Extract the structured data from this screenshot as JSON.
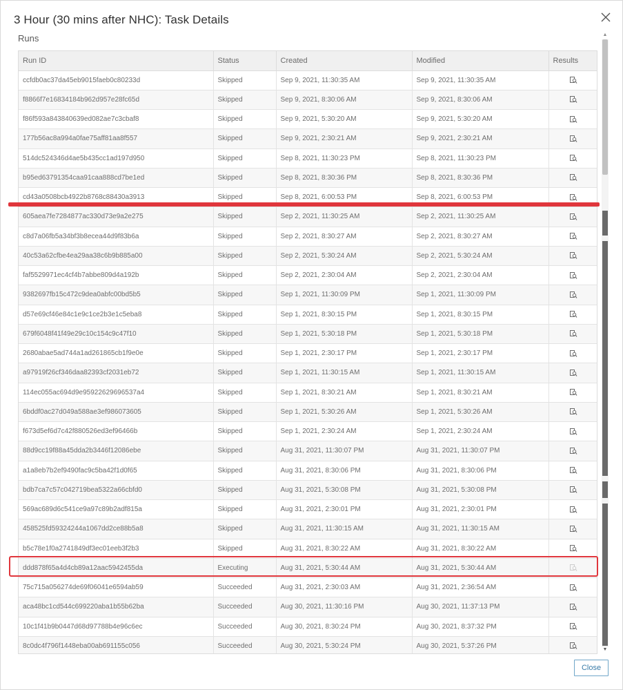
{
  "dialog": {
    "title": "3 Hour (30 mins after NHC): Task Details",
    "section_label": "Runs",
    "close_button_label": "Close"
  },
  "table": {
    "columns": [
      "Run ID",
      "Status",
      "Created",
      "Modified",
      "Results"
    ],
    "rows": [
      {
        "run_id": "ccfdb0ac37da45eb9015faeb0c80233d",
        "status": "Skipped",
        "created": "Sep 9, 2021, 11:30:35 AM",
        "modified": "Sep 9, 2021, 11:30:35 AM",
        "results_icon": "view-results-icon",
        "results_enabled": true
      },
      {
        "run_id": "f8866f7e16834184b962d957e28fc65d",
        "status": "Skipped",
        "created": "Sep 9, 2021, 8:30:06 AM",
        "modified": "Sep 9, 2021, 8:30:06 AM",
        "results_icon": "view-results-icon",
        "results_enabled": true
      },
      {
        "run_id": "f86f593a843840639ed082ae7c3cbaf8",
        "status": "Skipped",
        "created": "Sep 9, 2021, 5:30:20 AM",
        "modified": "Sep 9, 2021, 5:30:20 AM",
        "results_icon": "view-results-icon",
        "results_enabled": true
      },
      {
        "run_id": "177b56ac8a994a0fae75aff81aa8f557",
        "status": "Skipped",
        "created": "Sep 9, 2021, 2:30:21 AM",
        "modified": "Sep 9, 2021, 2:30:21 AM",
        "results_icon": "view-results-icon",
        "results_enabled": true
      },
      {
        "run_id": "514dc524346d4ae5b435cc1ad197d950",
        "status": "Skipped",
        "created": "Sep 8, 2021, 11:30:23 PM",
        "modified": "Sep 8, 2021, 11:30:23 PM",
        "results_icon": "view-results-icon",
        "results_enabled": true
      },
      {
        "run_id": "b95ed63791354caa91caa888cd7be1ed",
        "status": "Skipped",
        "created": "Sep 8, 2021, 8:30:36 PM",
        "modified": "Sep 8, 2021, 8:30:36 PM",
        "results_icon": "view-results-icon",
        "results_enabled": true
      },
      {
        "run_id": "cd43a0508bcb4922b8768c88430a3913",
        "status": "Skipped",
        "created": "Sep 8, 2021, 6:00:53 PM",
        "modified": "Sep 8, 2021, 6:00:53 PM",
        "results_icon": "view-results-icon",
        "results_enabled": true
      },
      {
        "run_id": "605aea7fe7284877ac330d73e9a2e275",
        "status": "Skipped",
        "created": "Sep 2, 2021, 11:30:25 AM",
        "modified": "Sep 2, 2021, 11:30:25 AM",
        "results_icon": "view-results-icon",
        "results_enabled": true
      },
      {
        "run_id": "c8d7a06fb5a34bf3b8ecea44d9f83b6a",
        "status": "Skipped",
        "created": "Sep 2, 2021, 8:30:27 AM",
        "modified": "Sep 2, 2021, 8:30:27 AM",
        "results_icon": "view-results-icon",
        "results_enabled": true
      },
      {
        "run_id": "40c53a62cfbe4ea29aa38c6b9b885a00",
        "status": "Skipped",
        "created": "Sep 2, 2021, 5:30:24 AM",
        "modified": "Sep 2, 2021, 5:30:24 AM",
        "results_icon": "view-results-icon",
        "results_enabled": true
      },
      {
        "run_id": "faf5529971ec4cf4b7abbe809d4a192b",
        "status": "Skipped",
        "created": "Sep 2, 2021, 2:30:04 AM",
        "modified": "Sep 2, 2021, 2:30:04 AM",
        "results_icon": "view-results-icon",
        "results_enabled": true
      },
      {
        "run_id": "9382697fb15c472c9dea0abfc00bd5b5",
        "status": "Skipped",
        "created": "Sep 1, 2021, 11:30:09 PM",
        "modified": "Sep 1, 2021, 11:30:09 PM",
        "results_icon": "view-results-icon",
        "results_enabled": true
      },
      {
        "run_id": "d57e69cf46e84c1e9c1ce2b3e1c5eba8",
        "status": "Skipped",
        "created": "Sep 1, 2021, 8:30:15 PM",
        "modified": "Sep 1, 2021, 8:30:15 PM",
        "results_icon": "view-results-icon",
        "results_enabled": true
      },
      {
        "run_id": "679f6048f41f49e29c10c154c9c47f10",
        "status": "Skipped",
        "created": "Sep 1, 2021, 5:30:18 PM",
        "modified": "Sep 1, 2021, 5:30:18 PM",
        "results_icon": "view-results-icon",
        "results_enabled": true
      },
      {
        "run_id": "2680abae5ad744a1ad261865cb1f9e0e",
        "status": "Skipped",
        "created": "Sep 1, 2021, 2:30:17 PM",
        "modified": "Sep 1, 2021, 2:30:17 PM",
        "results_icon": "view-results-icon",
        "results_enabled": true
      },
      {
        "run_id": "a97919f26cf346daa82393cf2031eb72",
        "status": "Skipped",
        "created": "Sep 1, 2021, 11:30:15 AM",
        "modified": "Sep 1, 2021, 11:30:15 AM",
        "results_icon": "view-results-icon",
        "results_enabled": true
      },
      {
        "run_id": "114ec055ac694d9e95922629696537a4",
        "status": "Skipped",
        "created": "Sep 1, 2021, 8:30:21 AM",
        "modified": "Sep 1, 2021, 8:30:21 AM",
        "results_icon": "view-results-icon",
        "results_enabled": true
      },
      {
        "run_id": "6bddf0ac27d049a588ae3ef986073605",
        "status": "Skipped",
        "created": "Sep 1, 2021, 5:30:26 AM",
        "modified": "Sep 1, 2021, 5:30:26 AM",
        "results_icon": "view-results-icon",
        "results_enabled": true
      },
      {
        "run_id": "f673d5ef6d7c42f880526ed3ef96466b",
        "status": "Skipped",
        "created": "Sep 1, 2021, 2:30:24 AM",
        "modified": "Sep 1, 2021, 2:30:24 AM",
        "results_icon": "view-results-icon",
        "results_enabled": true
      },
      {
        "run_id": "88d9cc19f88a45dda2b3446f12086ebe",
        "status": "Skipped",
        "created": "Aug 31, 2021, 11:30:07 PM",
        "modified": "Aug 31, 2021, 11:30:07 PM",
        "results_icon": "view-results-icon",
        "results_enabled": true
      },
      {
        "run_id": "a1a8eb7b2ef9490fac9c5ba42f1d0f65",
        "status": "Skipped",
        "created": "Aug 31, 2021, 8:30:06 PM",
        "modified": "Aug 31, 2021, 8:30:06 PM",
        "results_icon": "view-results-icon",
        "results_enabled": true
      },
      {
        "run_id": "bdb7ca7c57c042719bea5322a66cbfd0",
        "status": "Skipped",
        "created": "Aug 31, 2021, 5:30:08 PM",
        "modified": "Aug 31, 2021, 5:30:08 PM",
        "results_icon": "view-results-icon",
        "results_enabled": true
      },
      {
        "run_id": "569ac689d6c541ce9a97c89b2adf815a",
        "status": "Skipped",
        "created": "Aug 31, 2021, 2:30:01 PM",
        "modified": "Aug 31, 2021, 2:30:01 PM",
        "results_icon": "view-results-icon",
        "results_enabled": true
      },
      {
        "run_id": "458525fd59324244a1067dd2ce88b5a8",
        "status": "Skipped",
        "created": "Aug 31, 2021, 11:30:15 AM",
        "modified": "Aug 31, 2021, 11:30:15 AM",
        "results_icon": "view-results-icon",
        "results_enabled": true
      },
      {
        "run_id": "b5c78e1f0a2741849df3ec01eeb3f2b3",
        "status": "Skipped",
        "created": "Aug 31, 2021, 8:30:22 AM",
        "modified": "Aug 31, 2021, 8:30:22 AM",
        "results_icon": "view-results-icon",
        "results_enabled": true
      },
      {
        "run_id": "ddd878f65a4d4cb89a12aac5942455da",
        "status": "Executing",
        "created": "Aug 31, 2021, 5:30:44 AM",
        "modified": "Aug 31, 2021, 5:30:44 AM",
        "results_icon": "view-results-icon",
        "results_enabled": false
      },
      {
        "run_id": "75c715a056274de69f06041e6594ab59",
        "status": "Succeeded",
        "created": "Aug 31, 2021, 2:30:03 AM",
        "modified": "Aug 31, 2021, 2:36:54 AM",
        "results_icon": "view-results-icon",
        "results_enabled": true
      },
      {
        "run_id": "aca48bc1cd544c699220aba1b55b62ba",
        "status": "Succeeded",
        "created": "Aug 30, 2021, 11:30:16 PM",
        "modified": "Aug 30, 2021, 11:37:13 PM",
        "results_icon": "view-results-icon",
        "results_enabled": true
      },
      {
        "run_id": "10c1f41b9b0447d68d97788b4e96c6ec",
        "status": "Succeeded",
        "created": "Aug 30, 2021, 8:30:24 PM",
        "modified": "Aug 30, 2021, 8:37:32 PM",
        "results_icon": "view-results-icon",
        "results_enabled": true
      },
      {
        "run_id": "8c0dc4f796f1448eba00ab691155c056",
        "status": "Succeeded",
        "created": "Aug 30, 2021, 5:30:24 PM",
        "modified": "Aug 30, 2021, 5:37:26 PM",
        "results_icon": "view-results-icon",
        "results_enabled": true
      }
    ]
  },
  "annotations": {
    "color": "#e0363c"
  },
  "colors": {
    "accent": "#3a7ca8",
    "header_bg": "#f0f0f0"
  }
}
